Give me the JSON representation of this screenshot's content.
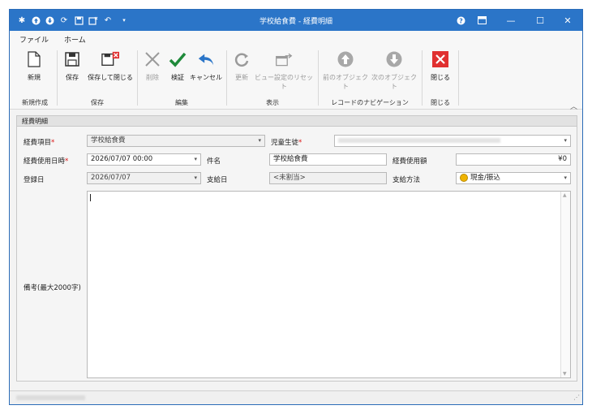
{
  "window": {
    "title": "学校給食費 - 経費明細"
  },
  "tabs": [
    "ファイル",
    "ホーム"
  ],
  "ribbon": {
    "buttons": {
      "new": "新規",
      "save": "保存",
      "save_close": "保存して閉じる",
      "delete": "削除",
      "validate": "検証",
      "cancel": "キャンセル",
      "refresh": "更新",
      "reset_view": "ビュー設定のリセット",
      "prev_object": "前のオブジェクト",
      "next_object": "次のオブジェクト",
      "close": "閉じる"
    },
    "groups": {
      "new": "新規作成",
      "save": "保存",
      "edit": "編集",
      "view": "表示",
      "record_nav": "レコードのナビゲーション",
      "close": "閉じる"
    }
  },
  "form": {
    "panel_title": "経費明細",
    "required_mark": "*",
    "expense_item": {
      "label": "経費項目",
      "value": "学校給食費"
    },
    "student": {
      "label": "児童生徒",
      "value": ""
    },
    "usage_datetime": {
      "label": "経費使用日時",
      "value": "2026/07/07 00:00"
    },
    "subject": {
      "label": "件名",
      "value": "学校給食費"
    },
    "amount": {
      "label": "経費使用額",
      "value": "¥0"
    },
    "register_date": {
      "label": "登録日",
      "value": "2026/07/07"
    },
    "payment_date": {
      "label": "支給日",
      "value": "<未割当>"
    },
    "payment_method": {
      "label": "支給方法",
      "value": "現金/振込"
    },
    "notes": {
      "label": "備考(最大2000字)",
      "value": ""
    }
  }
}
